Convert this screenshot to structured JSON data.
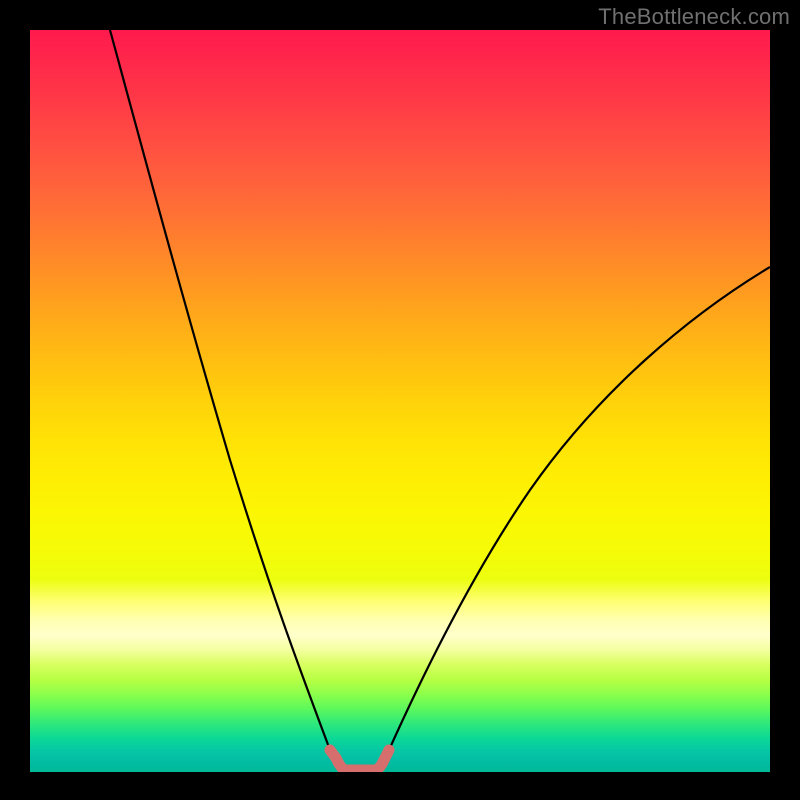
{
  "watermark": "TheBottleneck.com",
  "chart_data": {
    "type": "line",
    "title": "",
    "xlabel": "",
    "ylabel": "",
    "xlim": [
      0,
      100
    ],
    "ylim": [
      0,
      100
    ],
    "grid": false,
    "legend": false,
    "background": "rainbow-gradient (red top → green bottom)",
    "series": [
      {
        "name": "left-branch",
        "stroke": "#000000",
        "x": [
          10.8,
          14,
          18,
          22,
          26,
          30,
          34,
          36,
          38,
          40.5
        ],
        "y": [
          100,
          88,
          73,
          58,
          44,
          31,
          19,
          13,
          8,
          3
        ]
      },
      {
        "name": "right-branch",
        "stroke": "#000000",
        "x": [
          48.5,
          51,
          55,
          60,
          66,
          72,
          78,
          85,
          92,
          100
        ],
        "y": [
          3,
          8,
          16,
          25,
          35,
          43,
          50,
          57,
          63,
          68
        ]
      },
      {
        "name": "trough-marker",
        "stroke": "#d66e6e",
        "style": "thick stepped segment at valley floor with short vertical risers",
        "x": [
          40.5,
          41.5,
          42,
          48,
          48.5,
          49.5
        ],
        "y": [
          3,
          1,
          0.3,
          0.3,
          1,
          3
        ]
      }
    ],
    "notes": "V-shaped bottleneck curve on rainbow background; minimum plateau roughly x≈42–48, y≈0; left arm reaches y=100 near x≈11; right arm exits at x=100, y≈68."
  }
}
